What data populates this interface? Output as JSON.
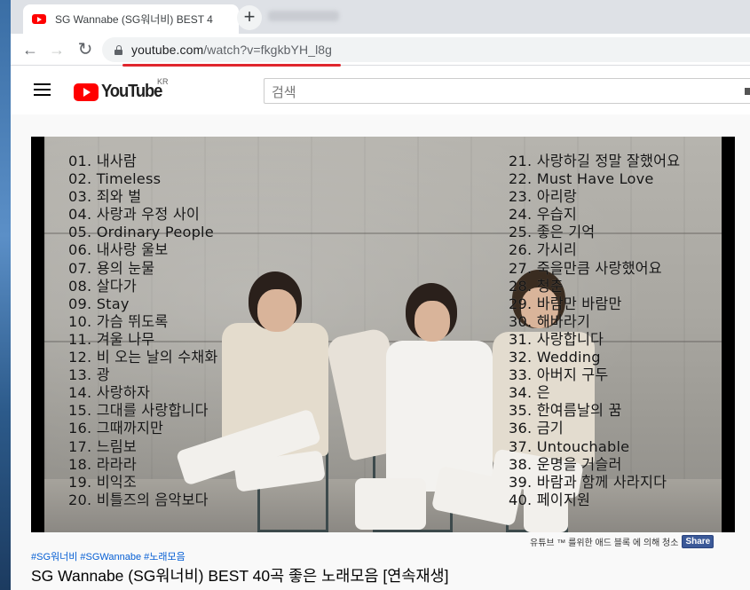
{
  "browser": {
    "tab_title": "SG Wannabe (SG워너비) BEST 4",
    "new_tab_symbol": "+",
    "url_host": "youtube.com",
    "url_path": "/watch?v=fkgkbYH_l8g",
    "colors": {
      "url_highlight": "#e0262d"
    }
  },
  "youtube": {
    "logo_text": "YouTube",
    "region": "KR",
    "search_placeholder": "검색"
  },
  "video": {
    "tracks_left": [
      "01. 내사람",
      "02. Timeless",
      "03. 죄와 벌",
      "04. 사랑과 우정 사이",
      "05. Ordinary People",
      "06. 내사랑 울보",
      "07. 용의 눈물",
      "08. 살다가",
      "09. Stay",
      "10. 가슴 뛰도록",
      "11. 겨울 나무",
      "12. 비 오는 날의 수채화",
      "13. 광",
      "14. 사랑하자",
      "15. 그대를 사랑합니다",
      "16. 그때까지만",
      "17. 느림보",
      "18. 라라라",
      "19. 비익조",
      "20. 비틀즈의 음악보다"
    ],
    "tracks_right": [
      "21. 사랑하길 정말 잘했어요",
      "22. Must Have Love",
      "23. 아리랑",
      "24. 우습지",
      "25. 좋은 기억",
      "26. 가시리",
      "27. 죽을만큼 사랑했어요",
      "28. 청춘",
      "29. 바람만 바람만",
      "30. 해바라기",
      "31. 사랑합니다",
      "32. Wedding",
      "33. 아버지 구두",
      "34. 은",
      "35. 한여름날의 꿈",
      "36. 금기",
      "37. Untouchable",
      "38. 운명을 거슬러",
      "39. 바람과 함께 사라지다",
      "40. 페이지원"
    ],
    "adblock_notice": "유튜브 ™ 를위한 애드 블록 에 의해 청소",
    "share_label": "Share",
    "hashtags": "#SG워너비 #SGWannabe #노래모음",
    "title": "SG Wannabe (SG워너비) BEST 40곡 좋은 노래모음 [연속재생]"
  }
}
